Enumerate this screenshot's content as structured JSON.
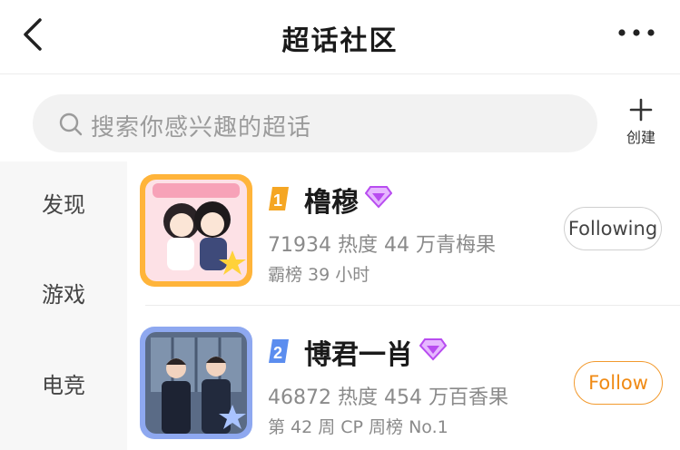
{
  "header": {
    "title": "超话社区",
    "back_icon": "chevron-left-icon",
    "more_icon": "more-horizontal-icon"
  },
  "search": {
    "placeholder": "搜索你感兴趣的超话"
  },
  "create": {
    "label": "创建",
    "icon": "plus-icon"
  },
  "sidebar": {
    "items": [
      {
        "label": "发现"
      },
      {
        "label": "游戏"
      },
      {
        "label": "电竞"
      }
    ]
  },
  "list": [
    {
      "rank": "1",
      "name": "橹穆",
      "stats": "71934 热度 44 万青梅果",
      "sub": "霸榜 39 小时",
      "button": "Following"
    },
    {
      "rank": "2",
      "name": "博君一肖",
      "stats": "46872 热度 454 万百香果",
      "sub": "第 42 周 CP 周榜 No.1",
      "button": "Follow"
    }
  ],
  "colors": {
    "rank1": "#f5a623",
    "rank2": "#5b8def",
    "follow": "#f08a14",
    "vip": "#b84cf0"
  }
}
